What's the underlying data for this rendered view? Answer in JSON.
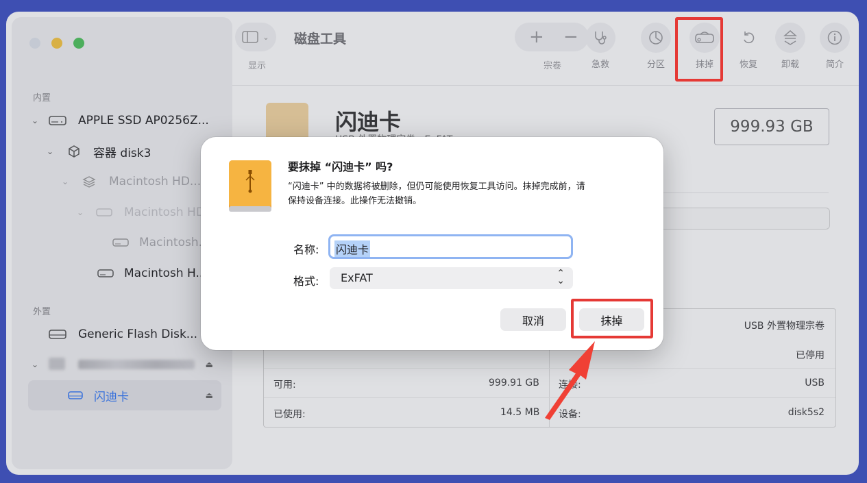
{
  "window": {
    "title": "磁盘工具",
    "view_label": "显示"
  },
  "sidebar": {
    "internal_title": "内置",
    "external_title": "外置",
    "items": [
      {
        "label": "APPLE SSD AP0256Z..."
      },
      {
        "label": "容器 disk3"
      },
      {
        "label": "Macintosh HD..."
      },
      {
        "label": "Macintosh HD"
      },
      {
        "label": "Macintosh..."
      },
      {
        "label": "Macintosh H..."
      },
      {
        "label": "Generic Flash Disk..."
      },
      {
        "label": ""
      },
      {
        "label": "闪迪卡"
      }
    ]
  },
  "toolbar": {
    "add_icon": "+",
    "remove_icon": "−",
    "volume_label": "宗卷",
    "firstaid_label": "急救",
    "partition_label": "分区",
    "erase_label": "抹掉",
    "restore_label": "恢复",
    "unmount_label": "卸载",
    "info_label": "简介"
  },
  "volume": {
    "name": "闪迪卡",
    "subtitle": "USB 外置物理宗卷 · ExFAT",
    "size": "999.93 GB"
  },
  "details": {
    "type_value": "USB 外置物理宗卷",
    "state_value": "已停用",
    "available_label": "可用:",
    "available_value": "999.91 GB",
    "connection_label": "连接:",
    "connection_value": "USB",
    "used_label": "已使用:",
    "used_value": "14.5 MB",
    "device_label": "设备:",
    "device_value": "disk5s2"
  },
  "dialog": {
    "title": "要抹掉 “闪迪卡” 吗?",
    "message_line1": "“闪迪卡” 中的数据将被删除，但仍可能使用恢复工具访问。抹掉完成前，请",
    "message_line2": "保持设备连接。此操作无法撤销。",
    "name_label": "名称:",
    "name_value": "闪迪卡",
    "format_label": "格式:",
    "format_value": "ExFAT",
    "cancel_label": "取消",
    "erase_label": "抹掉"
  },
  "colors": {
    "accent": "#3478f6",
    "annotation_red": "#e53935",
    "drive_orange": "#f0a030"
  }
}
